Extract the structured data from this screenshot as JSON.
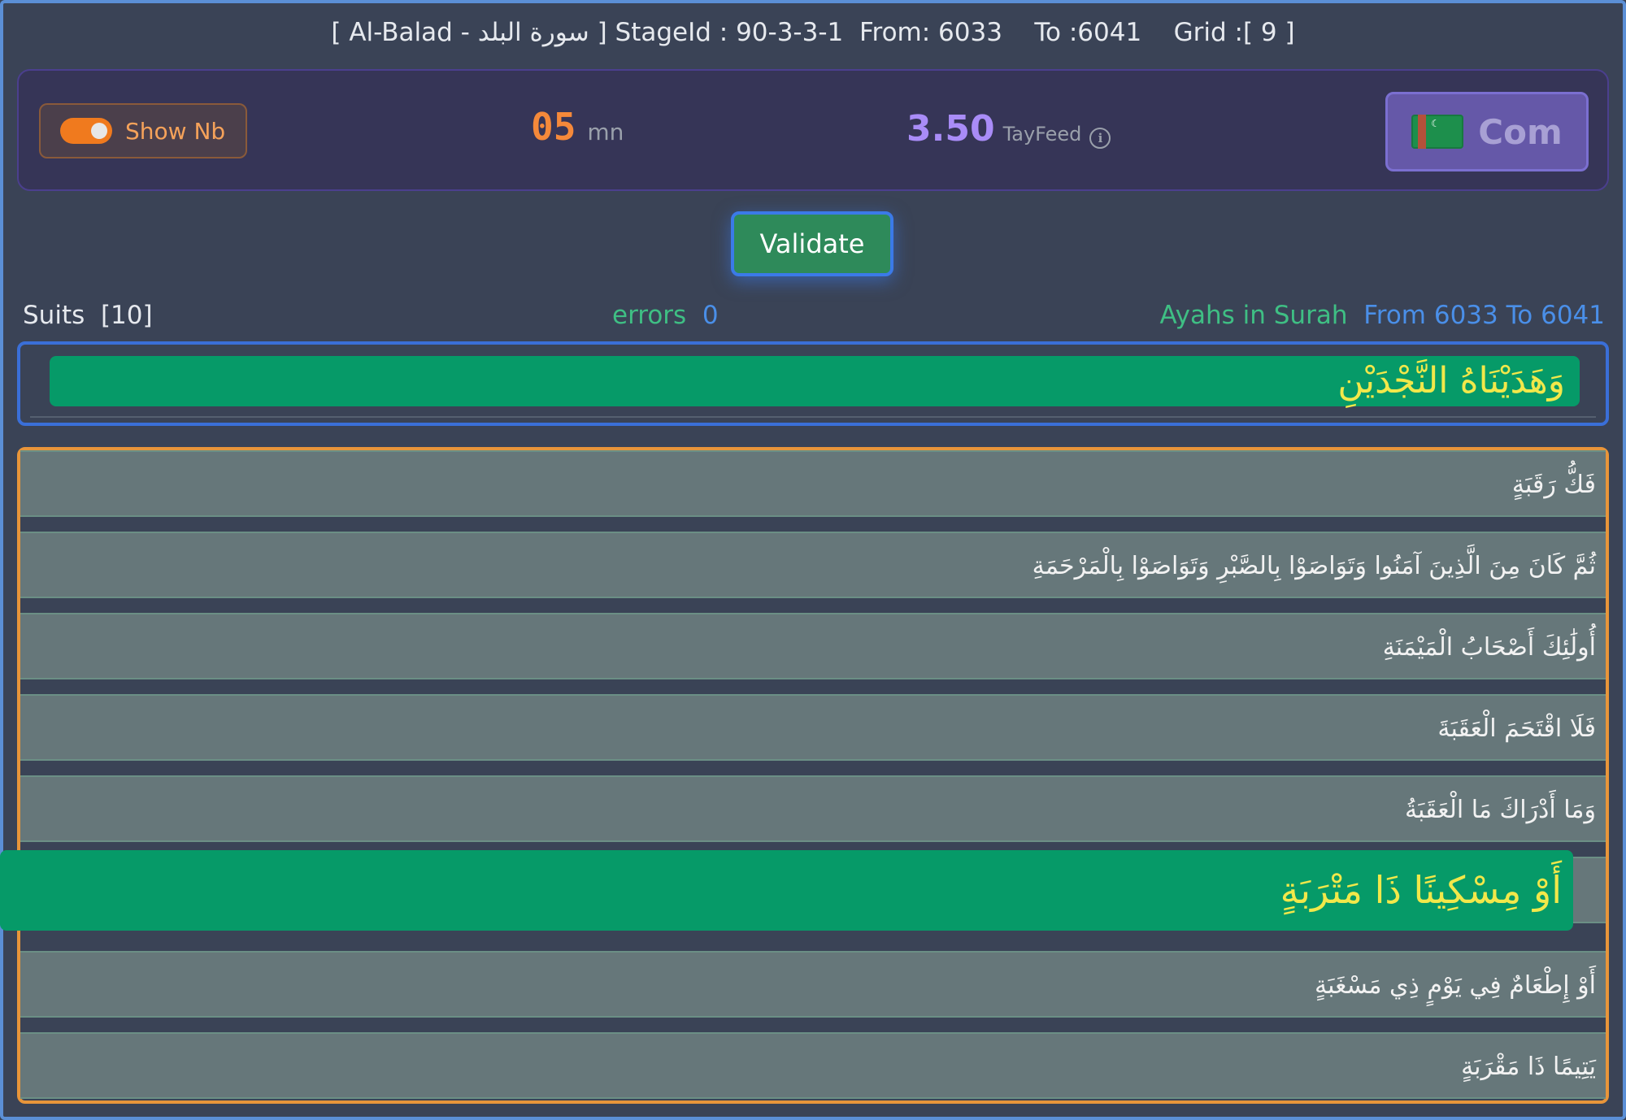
{
  "header": {
    "prefix": "[ Al-Balad - ",
    "surah_arabic": "سورة البلد",
    "suffix": " ] StageId : 90-3-3-1  From: 6033    To :6041    Grid :[ 9 ]"
  },
  "controls": {
    "toggle_label": "Show Nb",
    "toggle_on": true,
    "time_value": "05",
    "time_unit": "mn",
    "fee_value": "3.50",
    "fee_label": "TayFeed",
    "info_icon_glyph": "i",
    "com_label": "Com",
    "flag": "turkmenistan-flag-icon"
  },
  "validate_label": "Validate",
  "stats": {
    "suits_text": "Suits  [10]",
    "errors_label": "errors",
    "errors_value": "0",
    "ayahs_label": "Ayahs in Surah",
    "ayahs_range": "From 6033 To 6041"
  },
  "target_ayah": "وَهَدَيْنَاهُ النَّجْدَيْنِ",
  "ayah_rows": [
    "فَكُّ رَقَبَةٍ",
    "ثُمَّ كَانَ مِنَ الَّذِينَ آمَنُوا وَتَوَاصَوْا بِالصَّبْرِ وَتَوَاصَوْا بِالْمَرْحَمَةِ",
    "أُولَٰئِكَ أَصْحَابُ الْمَيْمَنَةِ",
    "فَلَا اقْتَحَمَ الْعَقَبَةَ",
    "وَمَا أَدْرَاكَ مَا الْعَقَبَةُ",
    "",
    "أَوْ إِطْعَامٌ فِي يَوْمٍ ذِي مَسْغَبَةٍ",
    "يَتِيمًا ذَا مَقْرَبَةٍ"
  ],
  "dragged_ayah": "أَوْ مِسْكِينًا ذَا مَتْرَبَةٍ",
  "colors": {
    "background": "#3a4356",
    "accent_green": "#069a68",
    "accent_yellow_text": "#f1e84a",
    "orange": "#f07a1e",
    "purple": "#a98cf7",
    "blue": "#3b7ae8"
  }
}
